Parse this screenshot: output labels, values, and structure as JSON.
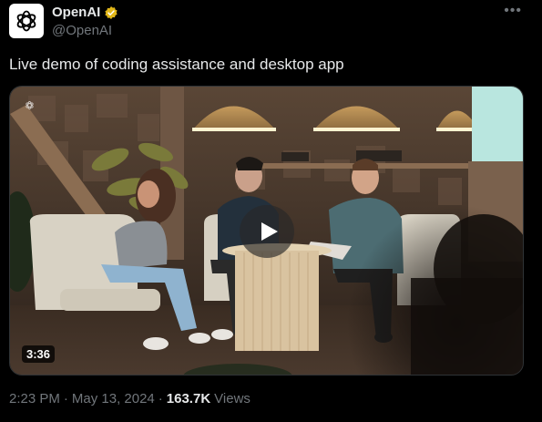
{
  "author": {
    "display_name": "OpenAI",
    "handle": "@OpenAI",
    "verified_icon": "verified-badge-icon",
    "avatar_icon": "openai-logo-icon"
  },
  "more_icon": "more-options-icon",
  "tweet": {
    "text": "Live demo of coding assistance and desktop app"
  },
  "video": {
    "duration": "3:36",
    "play_icon": "play-icon"
  },
  "meta": {
    "time": "2:23 PM",
    "separator": "·",
    "date": "May 13, 2024",
    "views_count": "163.7K",
    "views_label": "Views"
  },
  "colors": {
    "background": "#000000",
    "primary_text": "#e7e9ea",
    "secondary_text": "#71767b",
    "verified_gold": "#e2b719"
  }
}
